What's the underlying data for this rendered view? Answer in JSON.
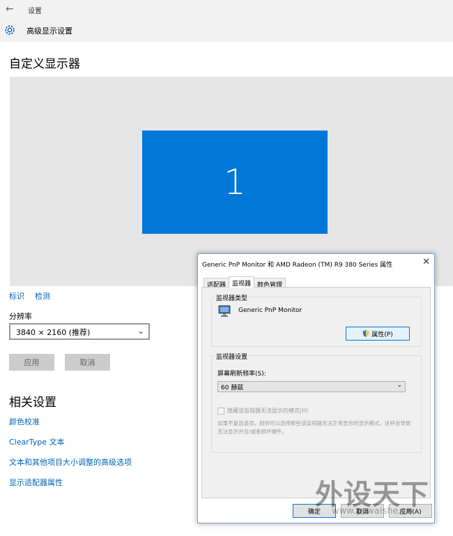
{
  "window": {
    "app_title": "设置",
    "page_heading": "高级显示设置"
  },
  "main": {
    "section_title": "自定义显示器",
    "monitor_number": "1",
    "links": {
      "identify": "标识",
      "detect": "检测"
    },
    "resolution_label": "分辨率",
    "resolution_value": "3840 × 2160 (推荐)",
    "apply_button": "应用",
    "cancel_button": "取消"
  },
  "related": {
    "title": "相关设置",
    "links": [
      "颜色校准",
      "ClearType 文本",
      "文本和其他项目大小调整的高级选项",
      "显示适配器属性"
    ]
  },
  "dialog": {
    "title": "Generic PnP Monitor 和 AMD Radeon (TM) R9 380 Series 属性",
    "tabs": [
      "适配器",
      "监视器",
      "颜色管理"
    ],
    "active_tab": "监视器",
    "monitor_type_group": "监视器类型",
    "monitor_name": "Generic PnP Monitor",
    "properties_button": "属性(P)",
    "settings_group": "监视器设置",
    "refresh_label": "屏幕刷新频率(S):",
    "refresh_value": "60 赫兹",
    "hide_modes_label": "隐藏该监视器无法显示的模式(H)",
    "hide_modes_checked": false,
    "info_text": "如果不复选该项，则你可以选择那些该监视器无法正常显示的显示模式。这样会导致无法显示并且/或者损坏硬件。",
    "ok_button": "确定",
    "cancel_button": "取消",
    "apply_button": "应用(A)"
  },
  "watermark": {
    "logo_text": "外设天下",
    "url": "www.pcwaishe.cn"
  },
  "colors": {
    "accent": "#0078d7",
    "link": "#0063b1",
    "chrome": "#f2f2f2",
    "preview_bg": "#e6e6e6"
  }
}
